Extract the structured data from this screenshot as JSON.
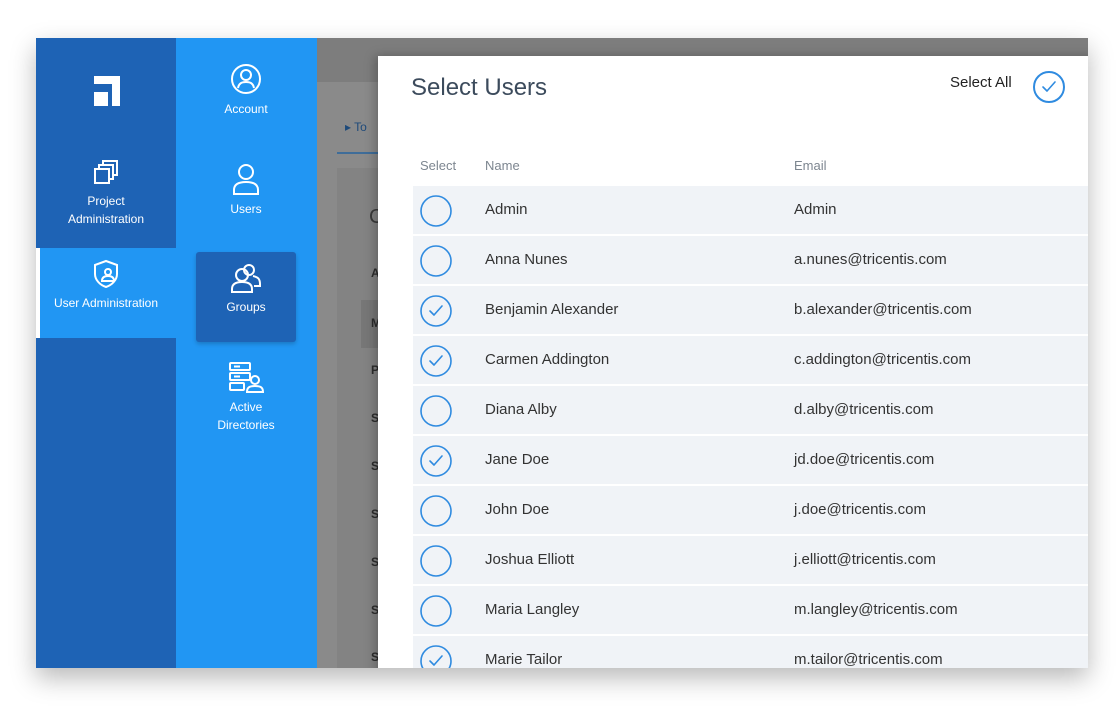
{
  "nav_primary": {
    "items": [
      {
        "label": "Project Administration",
        "lines": [
          "Project",
          "Administration"
        ],
        "icon": "project-admin-icon"
      },
      {
        "label": "User Administration",
        "icon": "user-shield-icon",
        "active": true
      }
    ]
  },
  "nav_secondary": {
    "items": [
      {
        "label": "Account",
        "icon": "account-icon"
      },
      {
        "label": "Users",
        "icon": "user-icon"
      },
      {
        "label": "Groups",
        "icon": "groups-icon",
        "active": true
      },
      {
        "label": "Active Directories",
        "lines": [
          "Active",
          "Directories"
        ],
        "icon": "active-directory-icon"
      }
    ]
  },
  "modal": {
    "title": "Select Users",
    "select_all_label": "Select All",
    "columns": {
      "select": "Select",
      "name": "Name",
      "email": "Email"
    },
    "rows": [
      {
        "name": "Admin",
        "email": "Admin",
        "checked": false
      },
      {
        "name": "Anna Nunes",
        "email": "a.nunes@tricentis.com",
        "checked": false
      },
      {
        "name": "Benjamin Alexander",
        "email": "b.alexander@tricentis.com",
        "checked": true
      },
      {
        "name": "Carmen Addington",
        "email": "c.addington@tricentis.com",
        "checked": true
      },
      {
        "name": "Diana Alby",
        "email": "d.alby@tricentis.com",
        "checked": false
      },
      {
        "name": "Jane Doe",
        "email": "jd.doe@tricentis.com",
        "checked": true
      },
      {
        "name": "John Doe",
        "email": "j.doe@tricentis.com",
        "checked": false
      },
      {
        "name": "Joshua Elliott",
        "email": "j.elliott@tricentis.com",
        "checked": false
      },
      {
        "name": "Maria Langley",
        "email": "m.langley@tricentis.com",
        "checked": false
      },
      {
        "name": "Marie Tailor",
        "email": "m.tailor@tricentis.com",
        "checked": true
      }
    ]
  },
  "background_page": {
    "tab_text": "▸ To",
    "heading_fragment": "C",
    "letters": [
      "A",
      "M",
      "P",
      "S",
      "S",
      "S",
      "S",
      "S",
      "S"
    ]
  },
  "colors": {
    "nav_primary": "#1e63b5",
    "nav_secondary": "#2196f3",
    "accent": "#2f8be0",
    "row_bg": "#f0f3f7"
  }
}
